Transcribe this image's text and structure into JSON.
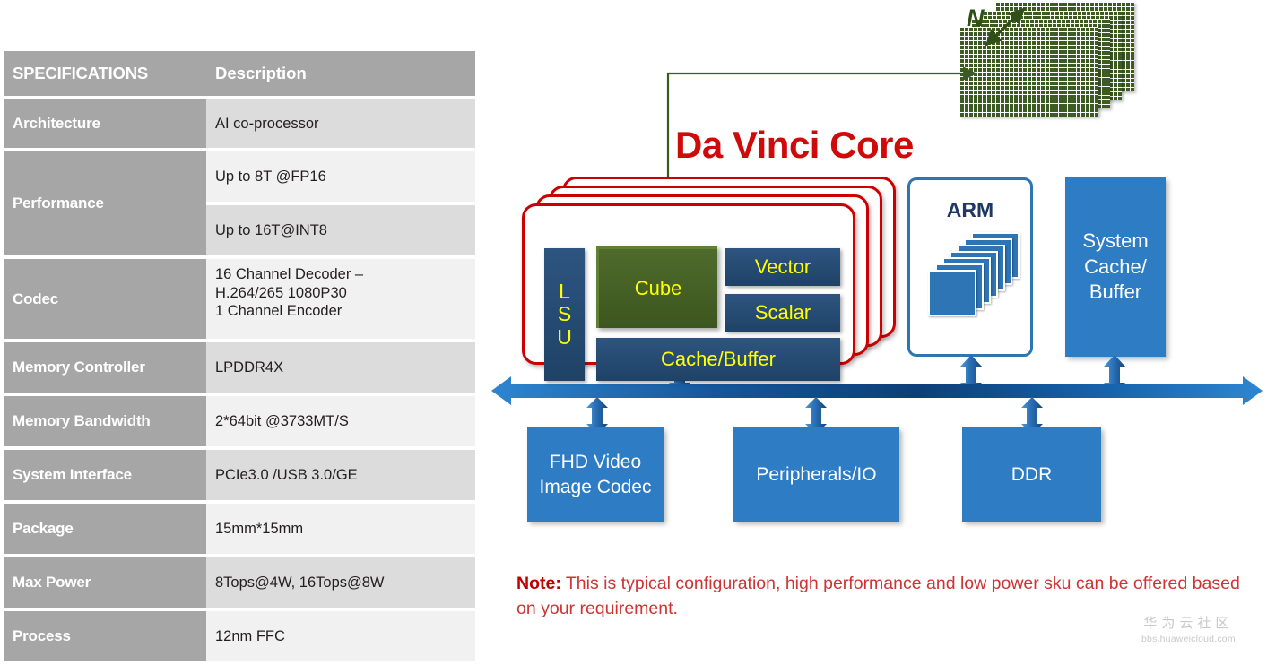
{
  "spec_table": {
    "header": {
      "col1": "SPECIFICATIONS",
      "col2": "Description"
    },
    "rows": [
      {
        "label": "Architecture",
        "values": [
          "AI co-processor"
        ]
      },
      {
        "label": "Performance",
        "values": [
          "Up to 8T @FP16",
          "Up to 16T@INT8"
        ]
      },
      {
        "label": "Codec",
        "values": [
          "16 Channel Decoder –\nH.264/265 1080P30\n1 Channel Encoder"
        ]
      },
      {
        "label": "Memory Controller",
        "values": [
          "LPDDR4X"
        ]
      },
      {
        "label": "Memory Bandwidth",
        "values": [
          "2*64bit @3733MT/S"
        ]
      },
      {
        "label": "System Interface",
        "values": [
          "PCIe3.0 /USB 3.0/GE"
        ]
      },
      {
        "label": "Package",
        "values": [
          "15mm*15mm"
        ]
      },
      {
        "label": "Max Power",
        "values": [
          "8Tops@4W, 16Tops@8W"
        ]
      },
      {
        "label": "Process",
        "values": [
          "12nm FFC"
        ]
      }
    ]
  },
  "diagram": {
    "title": "Da Vinci Core",
    "matrix_stack": {
      "dimension_label": "N"
    },
    "core_blocks": {
      "lsu": "LSU",
      "cube": "Cube",
      "vector": "Vector",
      "scalar": "Scalar",
      "cache_buffer": "Cache/Buffer"
    },
    "arm": {
      "label": "ARM"
    },
    "system_cache": {
      "label": "System\nCache/\nBuffer"
    },
    "bottom_blocks": [
      {
        "label": "FHD Video\nImage Codec"
      },
      {
        "label": "Peripherals/IO"
      },
      {
        "label": "DDR"
      }
    ]
  },
  "note": {
    "label": "Note:",
    "text": " This is typical configuration, high performance and low power sku can be offered based on your requirement."
  },
  "watermark": {
    "cn": "华为云社区",
    "url": "bbs.huaweicloud.com"
  },
  "colors": {
    "table_header_gray": "#a6a6a6",
    "table_value_gray": "#dcdcdc",
    "table_value_light": "#f1f1f1",
    "core_red": "#cc0000",
    "title_red": "#cf0a0a",
    "note_red": "#cf3333",
    "block_blue": "#2d5580",
    "cube_green": "#4e6b2b",
    "block_text_yellow": "#ffff00",
    "box_blue": "#2e7cc4",
    "matrix_green": "#3d5c23"
  }
}
